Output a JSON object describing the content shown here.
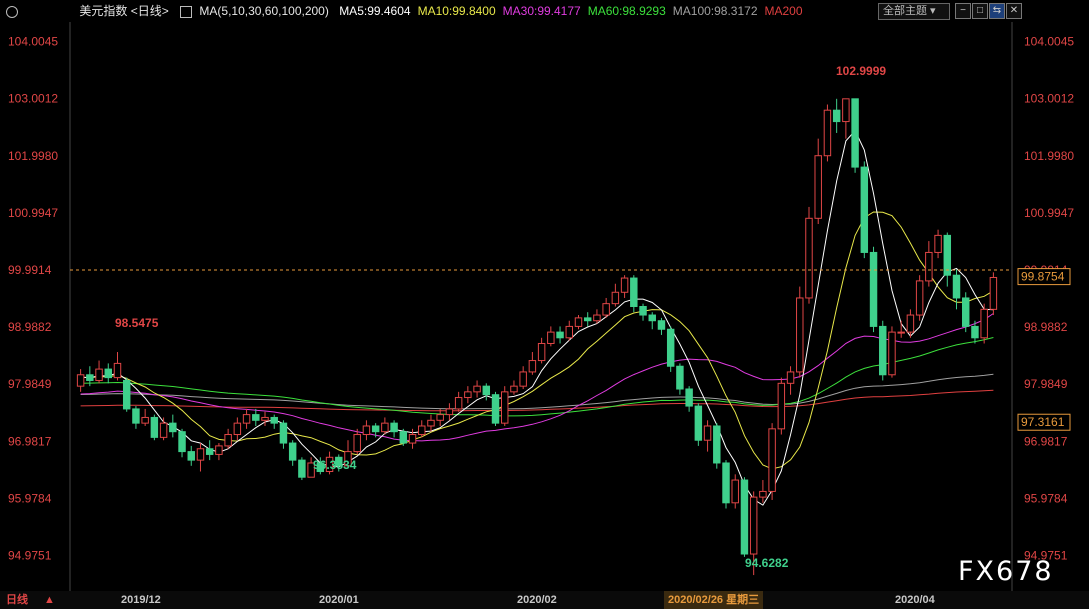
{
  "header": {
    "title": "美元指数",
    "period": "<日线>",
    "ma_params": "MA(5,10,30,60,100,200)",
    "ma_items": [
      {
        "label": "MA5:99.4604",
        "color": "#ffffff"
      },
      {
        "label": "MA10:99.8400",
        "color": "#e8e84a"
      },
      {
        "label": "MA30:99.4177",
        "color": "#e03ce0"
      },
      {
        "label": "MA60:98.9293",
        "color": "#3ce03c"
      },
      {
        "label": "MA100:98.3172",
        "color": "#a0a0a0"
      },
      {
        "label": "MA200",
        "color": "#e04040"
      }
    ],
    "theme_select": "全部主题",
    "buttons": [
      "−",
      "□",
      "⇆",
      "✕"
    ]
  },
  "bottom": {
    "period_label": "日线",
    "date_labels": [
      "2019/12",
      "2020/01",
      "2020/02",
      "2020/02/26 星期三",
      "2020/04"
    ]
  },
  "watermark": "FX678",
  "chart_data": {
    "type": "candlestick",
    "y_axis_labels": [
      "104.0045",
      "103.0012",
      "101.9980",
      "100.9947",
      "99.9914",
      "98.9882",
      "97.9849",
      "96.9817",
      "95.9784",
      "94.9751"
    ],
    "ylim": [
      94.35,
      104.35
    ],
    "current_price": "99.8754",
    "crosshair_price": "97.3161",
    "annotations": [
      {
        "text": "98.5475",
        "color": "#e04646"
      },
      {
        "text": "96.3534",
        "color": "#3fd08c"
      },
      {
        "text": "102.9999",
        "color": "#e04646"
      },
      {
        "text": "94.6282",
        "color": "#3fd08c"
      }
    ],
    "colors": {
      "up": "#e04646",
      "down": "#3fd08c",
      "ma5": "#ffffff",
      "ma10": "#e8e84a",
      "ma30": "#e03ce0",
      "ma60": "#3ce03c",
      "ma100": "#a0a0a0",
      "ma200": "#e04040"
    },
    "candles": [
      [
        97.95,
        98.15,
        98.25,
        97.85
      ],
      [
        98.15,
        98.05,
        98.3,
        97.95
      ],
      [
        98.05,
        98.25,
        98.4,
        98.0
      ],
      [
        98.25,
        98.1,
        98.35,
        98.0
      ],
      [
        98.1,
        98.35,
        98.55,
        98.05
      ],
      [
        98.05,
        97.55,
        98.1,
        97.5
      ],
      [
        97.55,
        97.3,
        97.6,
        97.2
      ],
      [
        97.3,
        97.4,
        97.55,
        97.25
      ],
      [
        97.4,
        97.05,
        97.45,
        97.0
      ],
      [
        97.05,
        97.3,
        97.4,
        97.0
      ],
      [
        97.3,
        97.15,
        97.45,
        97.05
      ],
      [
        97.15,
        96.8,
        97.2,
        96.7
      ],
      [
        96.8,
        96.65,
        96.9,
        96.55
      ],
      [
        96.65,
        96.85,
        96.95,
        96.45
      ],
      [
        96.85,
        96.75,
        97.0,
        96.65
      ],
      [
        96.75,
        96.9,
        96.95,
        96.65
      ],
      [
        96.9,
        97.1,
        97.2,
        96.85
      ],
      [
        97.1,
        97.3,
        97.4,
        97.0
      ],
      [
        97.3,
        97.45,
        97.55,
        97.2
      ],
      [
        97.45,
        97.35,
        97.55,
        97.25
      ],
      [
        97.35,
        97.4,
        97.5,
        97.25
      ],
      [
        97.4,
        97.3,
        97.45,
        97.2
      ],
      [
        97.3,
        96.95,
        97.35,
        96.85
      ],
      [
        96.95,
        96.65,
        97.0,
        96.55
      ],
      [
        96.65,
        96.35,
        96.7,
        96.3
      ],
      [
        96.35,
        96.6,
        96.7,
        96.35
      ],
      [
        96.6,
        96.45,
        96.7,
        96.4
      ],
      [
        96.45,
        96.7,
        96.8,
        96.4
      ],
      [
        96.7,
        96.55,
        96.75,
        96.45
      ],
      [
        96.55,
        96.8,
        97.0,
        96.5
      ],
      [
        96.8,
        97.1,
        97.2,
        96.75
      ],
      [
        97.1,
        97.25,
        97.35,
        97.0
      ],
      [
        97.25,
        97.15,
        97.3,
        97.05
      ],
      [
        97.15,
        97.3,
        97.4,
        97.1
      ],
      [
        97.3,
        97.15,
        97.35,
        97.05
      ],
      [
        97.15,
        96.95,
        97.2,
        96.9
      ],
      [
        96.95,
        97.1,
        97.2,
        96.85
      ],
      [
        97.1,
        97.25,
        97.35,
        97.05
      ],
      [
        97.25,
        97.35,
        97.45,
        97.15
      ],
      [
        97.35,
        97.45,
        97.55,
        97.25
      ],
      [
        97.45,
        97.55,
        97.65,
        97.35
      ],
      [
        97.55,
        97.75,
        97.85,
        97.5
      ],
      [
        97.75,
        97.85,
        97.95,
        97.65
      ],
      [
        97.85,
        97.95,
        98.05,
        97.75
      ],
      [
        97.95,
        97.8,
        98.0,
        97.7
      ],
      [
        97.8,
        97.3,
        97.85,
        97.25
      ],
      [
        97.3,
        97.85,
        97.95,
        97.25
      ],
      [
        97.85,
        97.95,
        98.05,
        97.8
      ],
      [
        97.95,
        98.2,
        98.3,
        97.9
      ],
      [
        98.2,
        98.4,
        98.55,
        98.15
      ],
      [
        98.4,
        98.7,
        98.8,
        98.35
      ],
      [
        98.7,
        98.9,
        99.0,
        98.65
      ],
      [
        98.9,
        98.8,
        99.0,
        98.7
      ],
      [
        98.8,
        99.0,
        99.1,
        98.75
      ],
      [
        99.0,
        99.15,
        99.2,
        98.95
      ],
      [
        99.15,
        99.1,
        99.25,
        99.0
      ],
      [
        99.1,
        99.2,
        99.3,
        99.05
      ],
      [
        99.2,
        99.4,
        99.5,
        99.15
      ],
      [
        99.4,
        99.6,
        99.75,
        99.35
      ],
      [
        99.6,
        99.85,
        99.9,
        99.5
      ],
      [
        99.85,
        99.35,
        99.9,
        99.25
      ],
      [
        99.35,
        99.2,
        99.4,
        99.1
      ],
      [
        99.2,
        99.1,
        99.25,
        98.95
      ],
      [
        99.1,
        98.95,
        99.15,
        98.85
      ],
      [
        98.95,
        98.3,
        99.0,
        98.2
      ],
      [
        98.3,
        97.9,
        98.35,
        97.8
      ],
      [
        97.9,
        97.6,
        97.95,
        97.5
      ],
      [
        97.6,
        97.0,
        97.65,
        96.9
      ],
      [
        97.0,
        97.25,
        97.35,
        96.8
      ],
      [
        97.25,
        96.6,
        97.3,
        96.5
      ],
      [
        96.6,
        95.9,
        96.65,
        95.8
      ],
      [
        95.9,
        96.3,
        96.4,
        95.8
      ],
      [
        96.3,
        95.0,
        96.35,
        94.95
      ],
      [
        95.0,
        96.0,
        96.1,
        94.63
      ],
      [
        96.0,
        96.1,
        96.3,
        95.9
      ],
      [
        96.1,
        97.2,
        97.3,
        95.95
      ],
      [
        97.2,
        98.0,
        98.1,
        97.1
      ],
      [
        98.0,
        98.2,
        98.3,
        97.8
      ],
      [
        98.2,
        99.5,
        99.7,
        98.1
      ],
      [
        99.5,
        100.9,
        101.1,
        99.4
      ],
      [
        100.9,
        102.0,
        102.3,
        100.8
      ],
      [
        102.0,
        102.8,
        102.9,
        101.9
      ],
      [
        102.8,
        102.6,
        103.0,
        102.4
      ],
      [
        102.6,
        103.0,
        103.0,
        102.3
      ],
      [
        103.0,
        101.8,
        103.0,
        101.7
      ],
      [
        101.8,
        100.3,
        101.9,
        100.2
      ],
      [
        100.3,
        99.0,
        100.4,
        98.9
      ],
      [
        99.0,
        98.15,
        99.1,
        98.05
      ],
      [
        98.15,
        98.9,
        99.0,
        98.1
      ],
      [
        98.9,
        98.9,
        99.1,
        98.8
      ],
      [
        98.9,
        99.2,
        99.3,
        98.8
      ],
      [
        99.2,
        99.8,
        99.9,
        99.1
      ],
      [
        99.8,
        100.3,
        100.5,
        99.7
      ],
      [
        100.3,
        100.6,
        100.7,
        100.2
      ],
      [
        100.6,
        99.9,
        100.65,
        99.7
      ],
      [
        99.9,
        99.5,
        100.0,
        99.3
      ],
      [
        99.5,
        99.0,
        99.6,
        98.9
      ],
      [
        99.0,
        98.8,
        99.1,
        98.7
      ],
      [
        98.8,
        99.3,
        99.4,
        98.7
      ],
      [
        99.3,
        99.86,
        99.95,
        99.2
      ]
    ]
  }
}
